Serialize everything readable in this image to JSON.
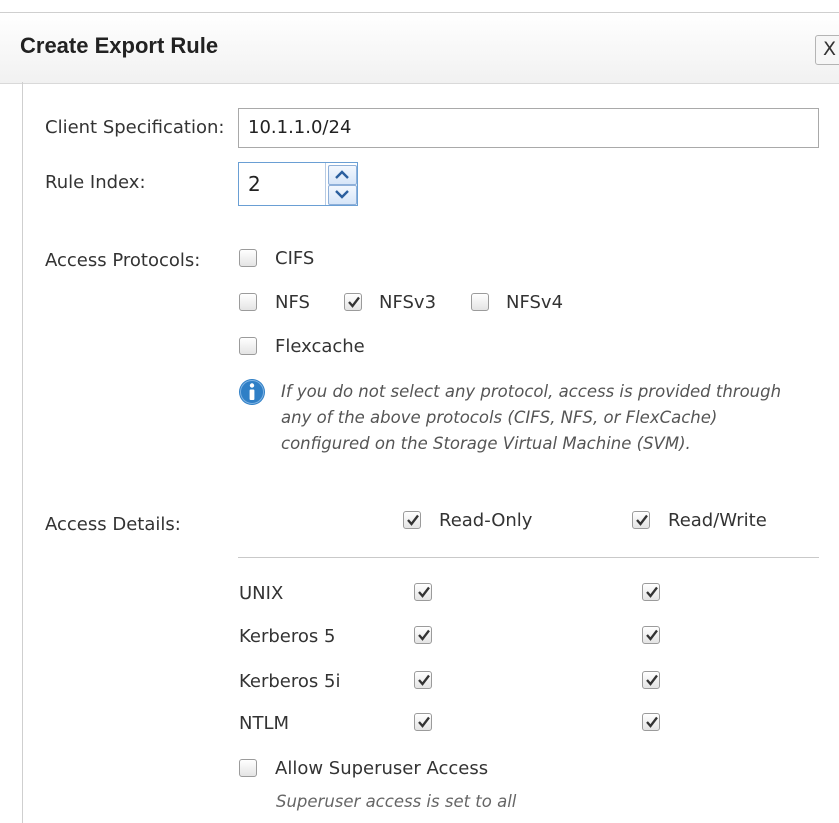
{
  "dialog": {
    "title": "Create Export Rule",
    "close_glyph": "X"
  },
  "client_spec": {
    "label": "Client Specification:",
    "value": "10.1.1.0/24"
  },
  "rule_index": {
    "label": "Rule Index:",
    "value": "2"
  },
  "access_protocols": {
    "label": "Access Protocols:",
    "options": [
      {
        "label": "CIFS",
        "checked": false
      },
      {
        "label": "NFS",
        "checked": false
      },
      {
        "label": "NFSv3",
        "checked": true
      },
      {
        "label": "NFSv4",
        "checked": false
      },
      {
        "label": "Flexcache",
        "checked": false
      }
    ],
    "info_text": "If you do not select any protocol, access is provided through any of the above protocols (CIFS, NFS, or FlexCache) configured on the Storage Virtual Machine (SVM)."
  },
  "access_details": {
    "label": "Access Details:",
    "columns": [
      {
        "label": "Read-Only",
        "checked": true
      },
      {
        "label": "Read/Write",
        "checked": true
      }
    ],
    "rows": [
      {
        "label": "UNIX",
        "read_only": true,
        "read_write": true
      },
      {
        "label": "Kerberos 5",
        "read_only": true,
        "read_write": true
      },
      {
        "label": "Kerberos 5i",
        "read_only": true,
        "read_write": true
      },
      {
        "label": "NTLM",
        "read_only": true,
        "read_write": true
      }
    ]
  },
  "superuser": {
    "label": "Allow Superuser Access",
    "checked": false,
    "note": "Superuser access is set to all"
  },
  "colors": {
    "info_icon": "#2f7fc6",
    "stepper_border": "#6a9fd4"
  }
}
